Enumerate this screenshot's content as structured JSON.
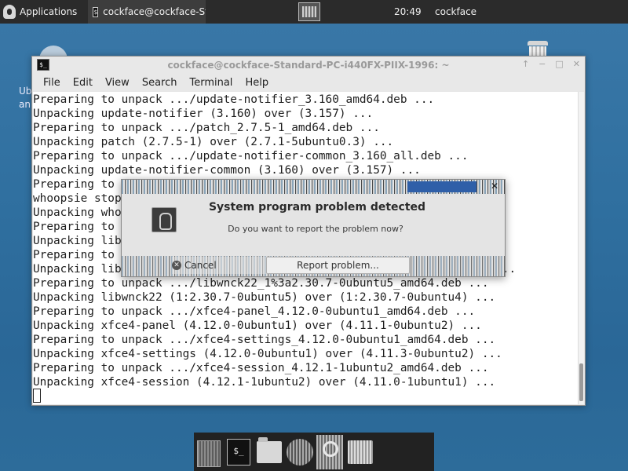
{
  "top_panel": {
    "applications_label": "Applications",
    "task_label": "cockface@cockface-Sta...",
    "clock": "20:49",
    "user": "cockface"
  },
  "desktop": {
    "partial_text": [
      "Ub",
      "an"
    ]
  },
  "terminal": {
    "title": "cockface@cockface-Standard-PC-i440FX-PIIX-1996: ~",
    "title_controls": [
      "↑",
      "−",
      "□",
      "✕"
    ],
    "menu": [
      "File",
      "Edit",
      "View",
      "Search",
      "Terminal",
      "Help"
    ],
    "lines": [
      "Preparing to unpack .../update-notifier_3.160_amd64.deb ...",
      "Unpacking update-notifier (3.160) over (3.157) ...",
      "Preparing to unpack .../patch_2.7.5-1_amd64.deb ...",
      "Unpacking patch (2.7.5-1) over (2.7.1-5ubuntu0.3) ...",
      "Preparing to unpack .../update-notifier-common_3.160_all.deb ...",
      "Unpacking update-notifier-common (3.160) over (3.157) ...",
      "Preparing to",
      "whoopsie stop",
      "Unpacking who",
      "Preparing to",
      "Unpacking lib",
      "Preparing to                                                     ...",
      "Unpacking lib                                                    4) ...",
      "Preparing to unpack .../libwnck22_1%3a2.30.7-0ubuntu5_amd64.deb ...",
      "Unpacking libwnck22 (1:2.30.7-0ubuntu5) over (1:2.30.7-0ubuntu4) ...",
      "Preparing to unpack .../xfce4-panel_4.12.0-0ubuntu1_amd64.deb ...",
      "Unpacking xfce4-panel (4.12.0-0ubuntu1) over (4.11.1-0ubuntu2) ...",
      "Preparing to unpack .../xfce4-settings_4.12.0-0ubuntu1_amd64.deb ...",
      "Unpacking xfce4-settings (4.12.0-0ubuntu1) over (4.11.3-0ubuntu2) ...",
      "Preparing to unpack .../xfce4-session_4.12.1-1ubuntu2_amd64.deb ...",
      "Unpacking xfce4-session (4.12.1-1ubuntu2) over (4.11.0-1ubuntu1) ..."
    ]
  },
  "dialog": {
    "heading": "System program problem detected",
    "question": "Do you want to report the problem now?",
    "cancel_label": "Cancel",
    "report_label": "Report problem..."
  },
  "dock": {
    "items": [
      "show-desktop",
      "terminal",
      "home-folder",
      "web-browser",
      "app-finder",
      "file-manager"
    ]
  }
}
